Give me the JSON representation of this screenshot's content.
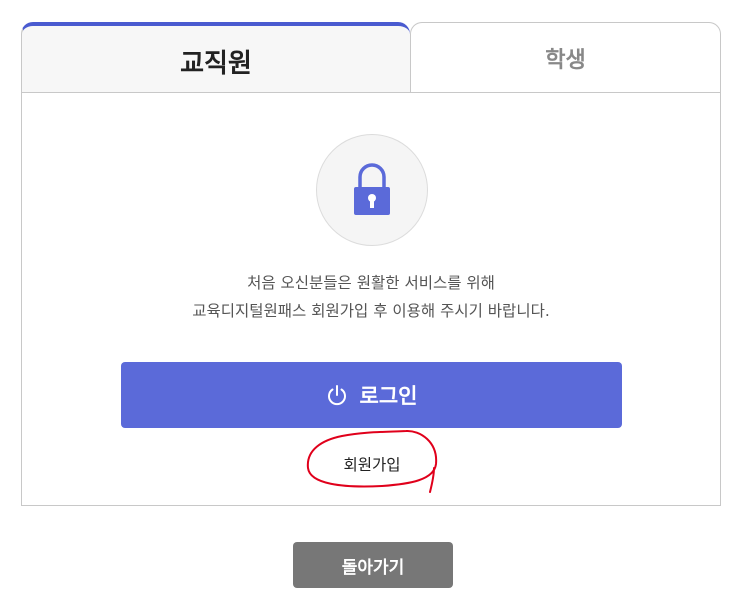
{
  "tabs": [
    {
      "label": "교직원",
      "active": true
    },
    {
      "label": "학생",
      "active": false
    }
  ],
  "lock": {
    "icon": "lock-icon",
    "color": "#5b6ad9"
  },
  "message": {
    "line1": "처음 오신분들은 원활한 서비스를 위해",
    "line2": "교육디지털원패스 회원가입 후 이용해 주시기 바랍니다."
  },
  "login": {
    "label": "로그인",
    "icon": "power-icon",
    "color": "#5b6ad9"
  },
  "signup": {
    "label": "회원가입"
  },
  "annotation": {
    "type": "red-hand-drawn-circle",
    "color": "#e0001b"
  },
  "back": {
    "label": "돌아가기",
    "color": "#777777"
  }
}
